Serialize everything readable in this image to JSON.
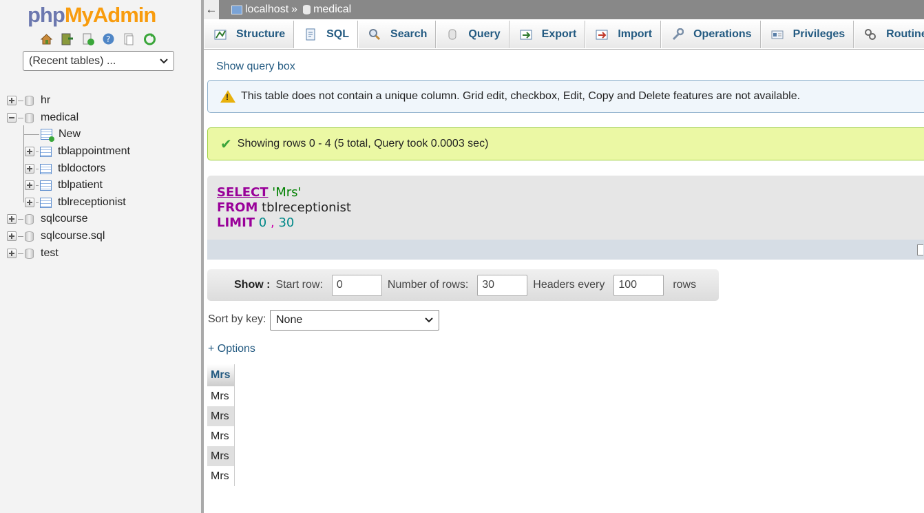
{
  "app": {
    "logo_php": "php",
    "logo_myadmin": "MyAdmin"
  },
  "nav": {
    "icons": [
      "home-icon",
      "exit-icon",
      "sql-icon",
      "help-icon",
      "docs-icon",
      "reload-icon"
    ],
    "recent_tables": "(Recent tables) ...",
    "tree": {
      "hr": "hr",
      "medical": "medical",
      "new": "New",
      "tblappointment": "tblappointment",
      "tbldoctors": "tbldoctors",
      "tblpatient": "tblpatient",
      "tblreceptionist": "tblreceptionist",
      "sqlcourse": "sqlcourse",
      "sqlcourse_sql": "sqlcourse.sql",
      "test": "test"
    }
  },
  "breadcrumb": {
    "back": "←",
    "server": "localhost",
    "sep": "»",
    "db": "medical"
  },
  "tabs": [
    "Structure",
    "SQL",
    "Search",
    "Query",
    "Export",
    "Import",
    "Operations",
    "Privileges",
    "Routines"
  ],
  "active_tab": "SQL",
  "main": {
    "show_query_box": "Show query box",
    "warning": "This table does not contain a unique column. Grid edit, checkbox, Edit, Copy and Delete features are not available.",
    "success": "Showing rows 0 - 4 (5 total, Query took 0.0003 sec)",
    "sql": {
      "select_kw": "SELECT",
      "select_val": "'Mrs'",
      "from_kw": "FROM",
      "from_val": "tblreceptionist",
      "limit_kw": "LIMIT",
      "limit_offset": "0",
      "limit_sep": ",",
      "limit_count": "30"
    },
    "nav_controls": {
      "show_label": "Show :",
      "start_row_label": "Start row:",
      "start_row": "0",
      "num_rows_label": "Number of rows:",
      "num_rows": "30",
      "headers_every_label": "Headers every",
      "headers_every": "100",
      "rows_label": "rows"
    },
    "sort_by_key_label": "Sort by key:",
    "sort_by_key_value": "None",
    "options": "+ Options",
    "results": {
      "column": "Mrs",
      "rows": [
        "Mrs",
        "Mrs",
        "Mrs",
        "Mrs",
        "Mrs"
      ]
    }
  },
  "colors": {
    "link": "#235a81",
    "warning_bg": "#f0f6fb",
    "success_bg": "#ebf8a4",
    "keyword": "#990099"
  }
}
